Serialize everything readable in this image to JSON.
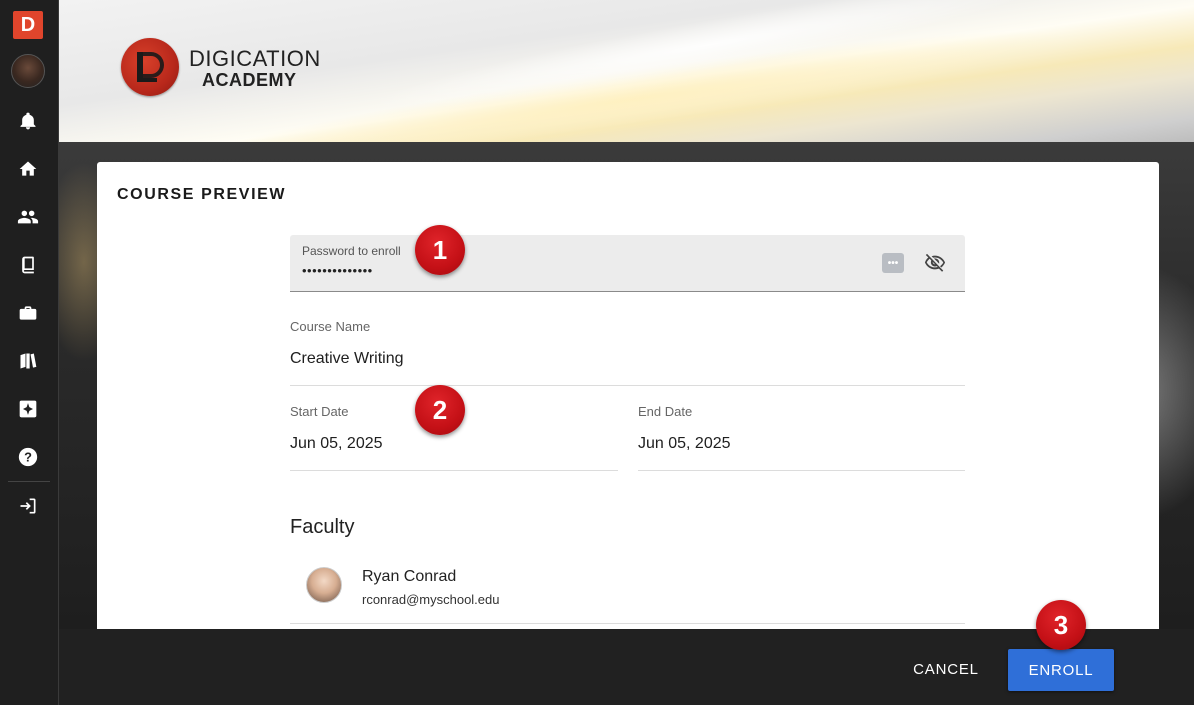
{
  "sidebar": {
    "brand_letter": "D",
    "items": [
      {
        "name": "notifications",
        "icon": "bell-icon"
      },
      {
        "name": "home",
        "icon": "home-icon"
      },
      {
        "name": "people",
        "icon": "people-icon"
      },
      {
        "name": "courses",
        "icon": "book-icon"
      },
      {
        "name": "portfolio",
        "icon": "briefcase-icon"
      },
      {
        "name": "library",
        "icon": "books-icon"
      },
      {
        "name": "ai-assistant",
        "icon": "sparkle-icon"
      },
      {
        "name": "help",
        "icon": "help-icon"
      },
      {
        "name": "logout",
        "icon": "logout-icon"
      }
    ]
  },
  "banner": {
    "logo_line1": "DIGICATION",
    "logo_line2": "ACADEMY"
  },
  "card": {
    "title": "COURSE PREVIEW",
    "password": {
      "label": "Password to enroll",
      "value": "••••••••••••••",
      "dots_button": "•••"
    },
    "course_name": {
      "label": "Course Name",
      "value": "Creative Writing"
    },
    "start_date": {
      "label": "Start Date",
      "value": "Jun 05, 2025"
    },
    "end_date": {
      "label": "End Date",
      "value": "Jun 05, 2025"
    },
    "faculty": {
      "heading": "Faculty",
      "members": [
        {
          "name": "Ryan Conrad",
          "email": "rconrad@myschool.edu"
        }
      ]
    }
  },
  "footer": {
    "cancel_label": "CANCEL",
    "enroll_label": "ENROLL"
  },
  "callouts": [
    "1",
    "2",
    "3"
  ],
  "colors": {
    "accent_blue": "#2f6fd8",
    "brand_red": "#e0452c",
    "callout_red": "#c41016"
  }
}
